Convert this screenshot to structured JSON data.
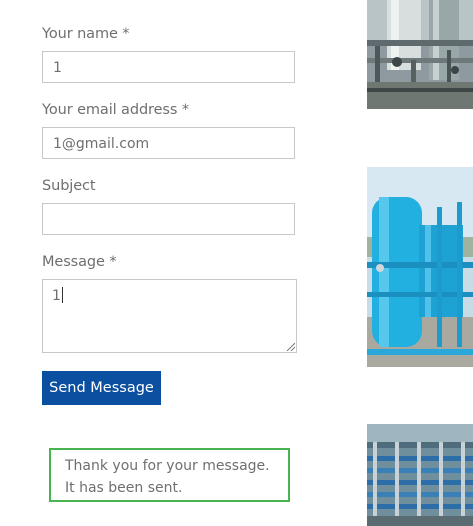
{
  "form": {
    "name_label": "Your name *",
    "name_value": "1",
    "email_label": "Your email address *",
    "email_value": "1@gmail.com",
    "subject_label": "Subject",
    "subject_value": "",
    "message_label": "Message *",
    "message_value": "1",
    "submit_label": "Send Message"
  },
  "notice": {
    "text": "Thank you for your message. It has been sent."
  },
  "gallery": {
    "images": [
      {
        "name": "industrial-pipes-photo"
      },
      {
        "name": "blue-water-treatment-tank-photo"
      },
      {
        "name": "membrane-filtration-plant-photo"
      }
    ]
  },
  "colors": {
    "button": "#0b4fa0",
    "success_border": "#46b450",
    "field_border": "#c8c8c8"
  }
}
